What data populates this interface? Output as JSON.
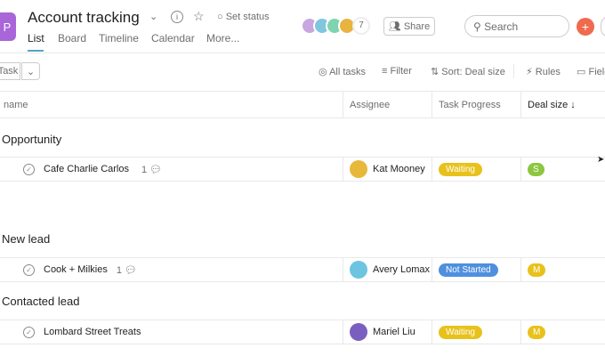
{
  "header": {
    "logo_glyph": "P",
    "title": "Account tracking",
    "set_status": "Set status",
    "member_count": "7",
    "share": "Share",
    "search_placeholder": "Search"
  },
  "tabs": [
    "List",
    "Board",
    "Timeline",
    "Calendar",
    "More..."
  ],
  "toolbar": {
    "add_task": "Task",
    "all_tasks": "All tasks",
    "filter": "Filter",
    "sort": "Sort: Deal size",
    "rules": "Rules",
    "fields": "Fields"
  },
  "columns": {
    "name": "name",
    "assignee": "Assignee",
    "progress": "Task Progress",
    "deal": "Deal size ↓"
  },
  "colors": {
    "accent": "#a966d8",
    "waiting": "#e8c21a",
    "not_started": "#4f8fdf",
    "small": "#8dc63f",
    "medium": "#e8c21a"
  },
  "sections": [
    {
      "title": "Opportunity",
      "tasks": [
        {
          "name": "Cafe Charlie Carlos",
          "comments": "1",
          "assignee": "Kat Mooney",
          "progress": "Waiting",
          "deal": "S"
        }
      ]
    },
    {
      "title": "New lead",
      "tasks": [
        {
          "name": "Cook + Milkies",
          "comments": "1",
          "assignee": "Avery Lomax",
          "progress": "Not Started",
          "deal": "M"
        }
      ]
    },
    {
      "title": "Contacted lead",
      "tasks": [
        {
          "name": "Lombard Street Treats",
          "comments": "",
          "assignee": "Mariel Liu",
          "progress": "Waiting",
          "deal": "M"
        }
      ]
    }
  ]
}
